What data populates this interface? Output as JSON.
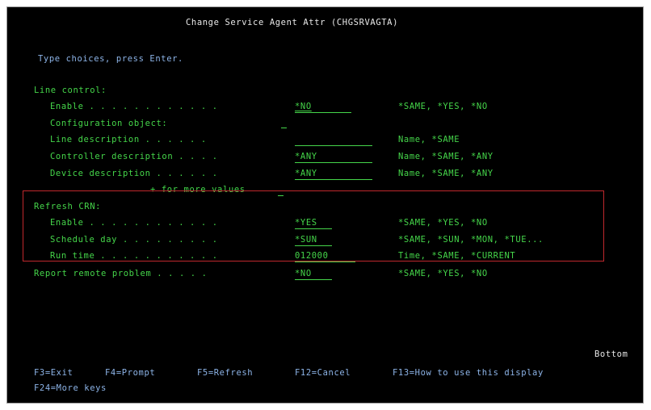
{
  "screen": {
    "title": "Change Service Agent Attr (CHGSRVAGTA)",
    "instruction": "Type choices, press Enter.",
    "line_control": {
      "heading": "Line control:",
      "enable": {
        "label": "Enable . . . . . . . . . . . .",
        "value": "*NO",
        "choices": "*SAME, *YES, *NO"
      },
      "configuration_object": {
        "label": "Configuration object:"
      },
      "line_description": {
        "label": "Line description . . . . . .",
        "value": "",
        "choices": "Name, *SAME"
      },
      "controller_description": {
        "label": "Controller description . . . .",
        "value": "*ANY",
        "choices": "Name, *SAME, *ANY"
      },
      "device_description": {
        "label": "Device description . . . . . .",
        "value": "*ANY",
        "choices": "Name, *SAME, *ANY"
      },
      "more_values": "+ for more values"
    },
    "refresh_ptfs": {
      "heading": "Refresh CRN:",
      "enable": {
        "label": "Enable . . . . . . . . . . . .",
        "value": "*YES",
        "choices": "*SAME, *YES, *NO"
      },
      "schedule_day": {
        "label": "Schedule day . . . . . . . . .",
        "value": "*SUN",
        "choices": "*SAME, *SUN, *MON, *TUE..."
      },
      "run_time": {
        "label": "Run time . . . . . . . . . . .",
        "value": "012000",
        "choices": "Time, *SAME, *CURRENT"
      }
    },
    "report_remote_problem": {
      "label": "Report remote problem . . . . .",
      "value": "*NO",
      "choices": "*SAME, *YES, *NO"
    },
    "bottom_indicator": "Bottom",
    "function_keys": {
      "f3": "F3=Exit",
      "f4": "F4=Prompt",
      "f5": "F5=Refresh",
      "f12": "F12=Cancel",
      "f13": "F13=How to use this display",
      "f24": "F24=More keys"
    },
    "colors": {
      "background": "#000000",
      "text_green": "#45d64a",
      "text_white": "#e8e8e8",
      "highlight_box": "#c0282d"
    }
  }
}
